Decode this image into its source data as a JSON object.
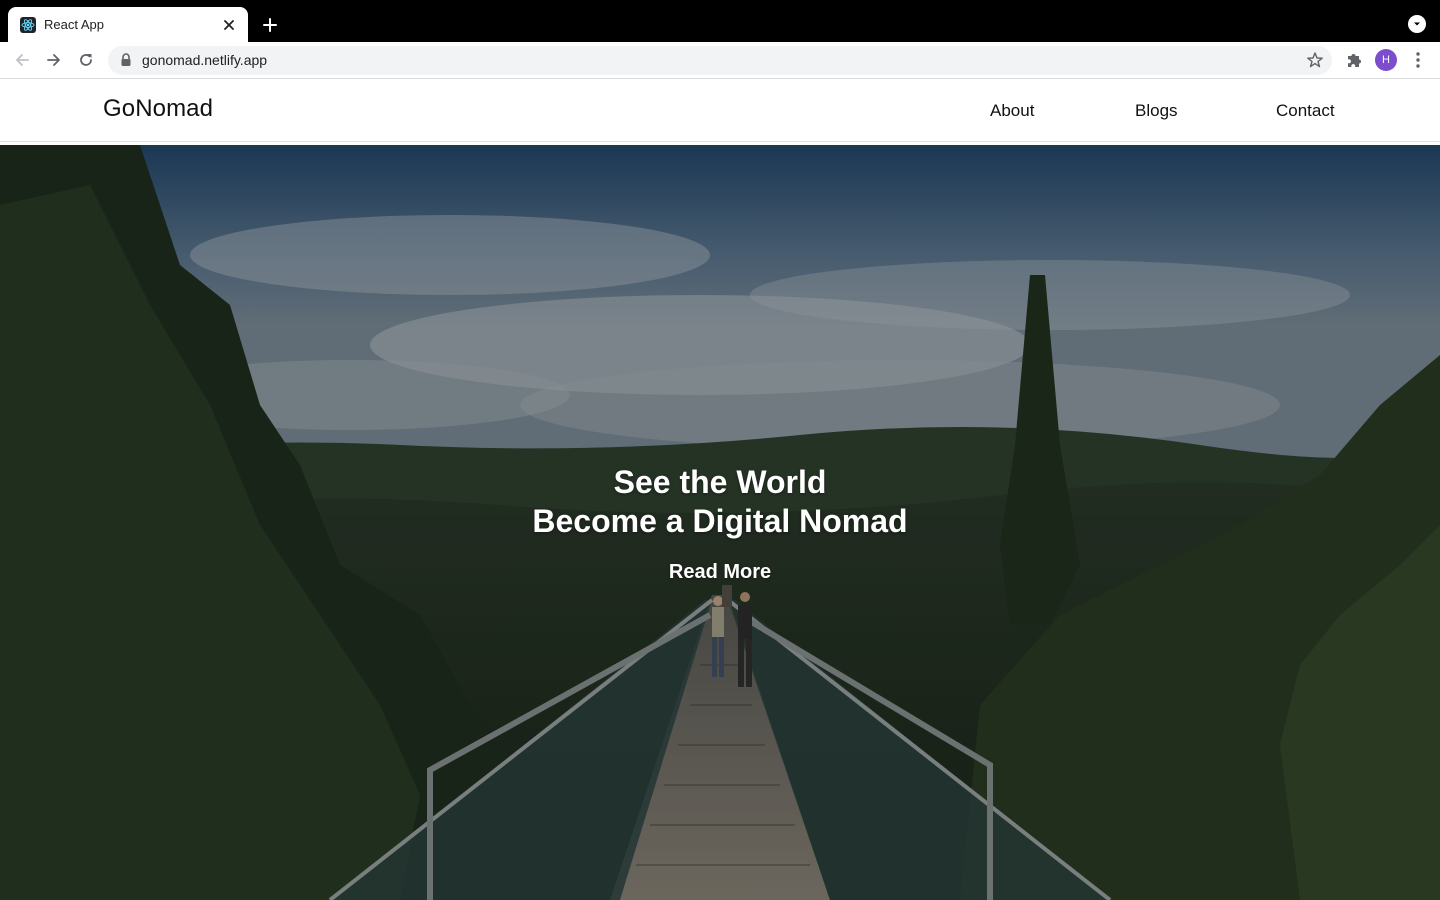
{
  "browser": {
    "tab": {
      "title": "React App",
      "favicon": "react-logo-icon"
    },
    "url": "gonomad.netlify.app",
    "profile_initial": "H",
    "colors": {
      "tabstrip": "#000000",
      "avatar": "#7c4dcc"
    }
  },
  "site": {
    "brand": "GoNomad",
    "nav": [
      {
        "label": "About"
      },
      {
        "label": "Blogs"
      },
      {
        "label": "Contact"
      }
    ]
  },
  "hero": {
    "line1": "See the World",
    "line2": "Become a Digital Nomad",
    "cta": "Read More",
    "background": "forest-suspension-bridge-photo"
  }
}
